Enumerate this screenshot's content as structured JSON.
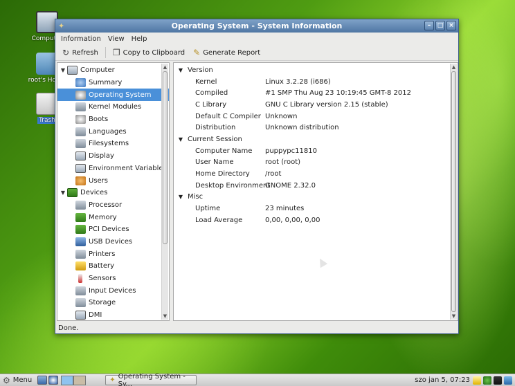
{
  "desktop": {
    "icons": [
      {
        "label": "Computer",
        "icon": "computer-icon"
      },
      {
        "label": "root's Home",
        "icon": "home-folder-icon"
      },
      {
        "label": "Trash",
        "icon": "trash-icon"
      }
    ]
  },
  "window": {
    "title": "Operating System - System Information",
    "menubar": [
      "Information",
      "View",
      "Help"
    ],
    "toolbar": {
      "refresh": "Refresh",
      "copy": "Copy to Clipboard",
      "report": "Generate Report"
    },
    "status": "Done."
  },
  "tree": {
    "computer": {
      "label": "Computer",
      "items": [
        "Summary",
        "Operating System",
        "Kernel Modules",
        "Boots",
        "Languages",
        "Filesystems",
        "Display",
        "Environment Variables",
        "Users"
      ]
    },
    "devices": {
      "label": "Devices",
      "items": [
        "Processor",
        "Memory",
        "PCI Devices",
        "USB Devices",
        "Printers",
        "Battery",
        "Sensors",
        "Input Devices",
        "Storage",
        "DMI"
      ]
    },
    "selected": "Operating System"
  },
  "info": {
    "sections": [
      {
        "name": "Version",
        "rows": [
          {
            "key": "Kernel",
            "value": "Linux 3.2.28 (i686)"
          },
          {
            "key": "Compiled",
            "value": "#1 SMP Thu Aug 23 10:19:45 GMT-8 2012"
          },
          {
            "key": "C Library",
            "value": "GNU C Library version 2.15 (stable)"
          },
          {
            "key": "Default C Compiler",
            "value": "Unknown"
          },
          {
            "key": "Distribution",
            "value": "Unknown distribution"
          }
        ]
      },
      {
        "name": "Current Session",
        "rows": [
          {
            "key": "Computer Name",
            "value": "puppypc11810"
          },
          {
            "key": "User Name",
            "value": "root (root)"
          },
          {
            "key": "Home Directory",
            "value": "/root"
          },
          {
            "key": "Desktop Environment",
            "value": "GNOME 2.32.0"
          }
        ]
      },
      {
        "name": "Misc",
        "rows": [
          {
            "key": "Uptime",
            "value": "23 minutes"
          },
          {
            "key": "Load Average",
            "value": "0,00, 0,00, 0,00"
          }
        ]
      }
    ]
  },
  "taskbar": {
    "menu_label": "Menu",
    "task_label": "Operating System - Sy...",
    "clock": "szo jan  5, 07:23"
  },
  "colors": {
    "titlebar": "#5f86b3",
    "selection": "#4a90d9",
    "desktop": "#4f9c12"
  }
}
